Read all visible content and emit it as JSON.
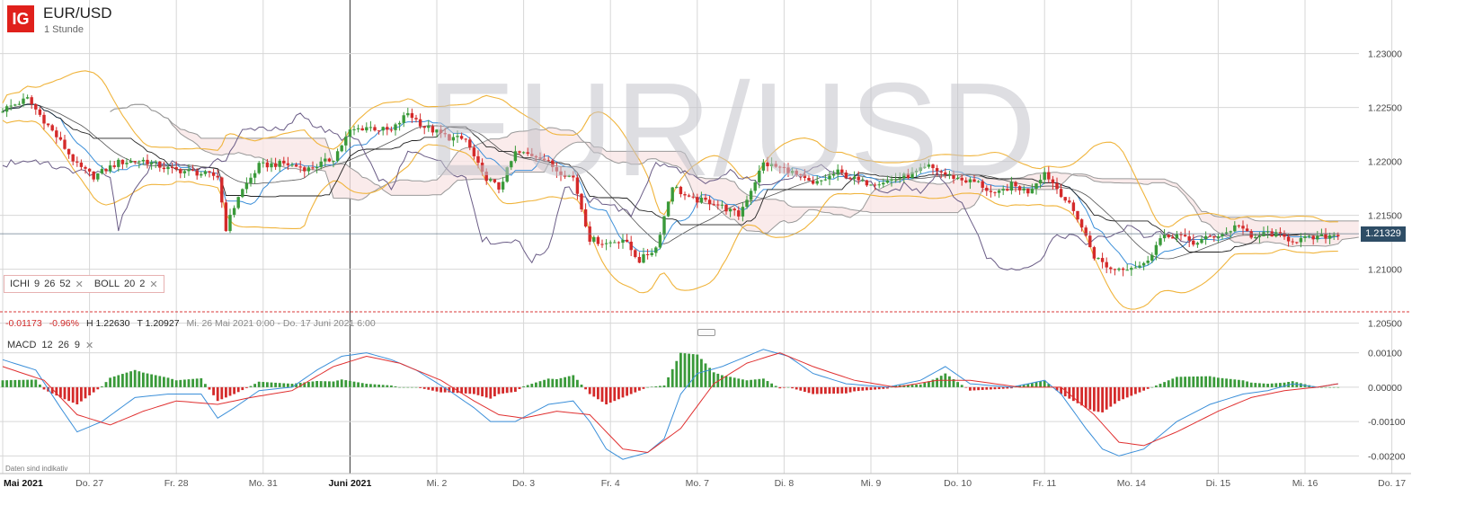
{
  "header": {
    "logo": "IG",
    "instrument": "EUR/USD",
    "interval": "1 Stunde",
    "watermark": "EUR/USD"
  },
  "indicators": {
    "ichi": {
      "name": "ICHI",
      "p1": "9",
      "p2": "26",
      "p3": "52"
    },
    "boll": {
      "name": "BOLL",
      "p1": "20",
      "p2": "2"
    },
    "macd": {
      "name": "MACD",
      "p1": "12",
      "p2": "26",
      "p3": "9"
    },
    "close_symbol": "✕"
  },
  "stats": {
    "change": "-0.01173",
    "change_pct": "-0.96%",
    "high": "H 1.22630",
    "low": "T 1.20927",
    "range": "Mi. 26 Mai 2021 0:00 - Do. 17 Juni 2021 6:00"
  },
  "footnote": "Daten sind indikativ",
  "current_price": "1.21329",
  "colors": {
    "up": "#3a9a3a",
    "down": "#d42a2a",
    "boll": "#f0b43c",
    "ichi_cloud": "#f9e6e6",
    "ichi_line": "#6a5c86",
    "price_tag": "#2e4d66"
  },
  "chart_data": [
    {
      "type": "candlestick",
      "title": "EUR/USD",
      "y_axis": {
        "range": [
          1.2048,
          1.2318
        ],
        "ticks": [
          "1.23000",
          "1.22500",
          "1.22000",
          "1.21500",
          "1.21000",
          "1.20500"
        ],
        "tick_values": [
          1.23,
          1.225,
          1.22,
          1.215,
          1.21,
          1.205
        ]
      },
      "x_axis": {
        "labels": [
          "Mai 2021",
          "Do. 27",
          "Fr. 28",
          "Mo. 31",
          "Juni 2021",
          "Mi. 2",
          "Do. 3",
          "Fr. 4",
          "Mo. 7",
          "Di. 8",
          "Mi. 9",
          "Do. 10",
          "Fr. 11",
          "Mo. 14",
          "Di. 15",
          "Mi. 16",
          "Do. 17"
        ],
        "label_index": [
          0,
          21,
          42,
          63,
          84,
          105,
          126,
          147,
          168,
          189,
          210,
          231,
          252,
          273,
          294,
          315,
          336
        ],
        "bars": 337
      },
      "grid": true,
      "indicators": [
        "Ichimoku (9, 26, 52)",
        "Bollinger (20, 2)"
      ],
      "close_path": [
        [
          0,
          1.2248
        ],
        [
          6,
          1.2258
        ],
        [
          10,
          1.2238
        ],
        [
          14,
          1.2218
        ],
        [
          18,
          1.2196
        ],
        [
          22,
          1.2186
        ],
        [
          28,
          1.2199
        ],
        [
          34,
          1.2201
        ],
        [
          40,
          1.2193
        ],
        [
          46,
          1.219
        ],
        [
          52,
          1.2186
        ],
        [
          54,
          1.2138
        ],
        [
          57,
          1.2168
        ],
        [
          62,
          1.2196
        ],
        [
          68,
          1.2198
        ],
        [
          74,
          1.2193
        ],
        [
          80,
          1.2203
        ],
        [
          84,
          1.2228
        ],
        [
          88,
          1.2232
        ],
        [
          94,
          1.2228
        ],
        [
          98,
          1.2245
        ],
        [
          102,
          1.2232
        ],
        [
          108,
          1.2222
        ],
        [
          112,
          1.222
        ],
        [
          116,
          1.2188
        ],
        [
          120,
          1.2175
        ],
        [
          124,
          1.2208
        ],
        [
          130,
          1.2205
        ],
        [
          134,
          1.2192
        ],
        [
          138,
          1.2185
        ],
        [
          142,
          1.2128
        ],
        [
          146,
          1.2124
        ],
        [
          150,
          1.2128
        ],
        [
          154,
          1.2108
        ],
        [
          158,
          1.212
        ],
        [
          162,
          1.2178
        ],
        [
          166,
          1.2165
        ],
        [
          172,
          1.2162
        ],
        [
          178,
          1.215
        ],
        [
          184,
          1.2198
        ],
        [
          190,
          1.2192
        ],
        [
          196,
          1.2178
        ],
        [
          202,
          1.219
        ],
        [
          208,
          1.218
        ],
        [
          214,
          1.2182
        ],
        [
          220,
          1.2188
        ],
        [
          224,
          1.2195
        ],
        [
          228,
          1.2188
        ],
        [
          232,
          1.2183
        ],
        [
          236,
          1.218
        ],
        [
          240,
          1.2168
        ],
        [
          244,
          1.2178
        ],
        [
          248,
          1.2172
        ],
        [
          252,
          1.219
        ],
        [
          256,
          1.217
        ],
        [
          260,
          1.2148
        ],
        [
          264,
          1.2112
        ],
        [
          268,
          1.21
        ],
        [
          272,
          1.2102
        ],
        [
          276,
          1.2104
        ],
        [
          280,
          1.2128
        ],
        [
          284,
          1.2132
        ],
        [
          288,
          1.2124
        ],
        [
          292,
          1.213
        ],
        [
          296,
          1.2134
        ],
        [
          299,
          1.2142
        ],
        [
          302,
          1.2128
        ],
        [
          306,
          1.2134
        ],
        [
          312,
          1.2127
        ],
        [
          318,
          1.2129
        ],
        [
          323,
          1.2133
        ]
      ],
      "last_price": 1.21329
    },
    {
      "type": "bar",
      "title": "MACD",
      "y_axis": {
        "range": [
          -0.0022,
          0.0012
        ],
        "ticks": [
          "0.00100",
          "0.00000",
          "-0.00100",
          "-0.00200"
        ],
        "tick_values": [
          0.001,
          0,
          -0.001,
          -0.002
        ]
      },
      "macd_path": [
        [
          0,
          0.0008
        ],
        [
          8,
          0.0005
        ],
        [
          14,
          -0.0006
        ],
        [
          18,
          -0.0013
        ],
        [
          24,
          -0.001
        ],
        [
          32,
          -0.0003
        ],
        [
          40,
          -0.0002
        ],
        [
          48,
          -0.0002
        ],
        [
          52,
          -0.0009
        ],
        [
          56,
          -0.0006
        ],
        [
          62,
          -0.0001
        ],
        [
          70,
          0.0
        ],
        [
          76,
          0.0005
        ],
        [
          82,
          0.0009
        ],
        [
          88,
          0.001
        ],
        [
          94,
          0.0008
        ],
        [
          100,
          0.0005
        ],
        [
          108,
          -0.0001
        ],
        [
          114,
          -0.0006
        ],
        [
          118,
          -0.001
        ],
        [
          124,
          -0.001
        ],
        [
          132,
          -0.0005
        ],
        [
          138,
          -0.0004
        ],
        [
          142,
          -0.001
        ],
        [
          146,
          -0.0018
        ],
        [
          150,
          -0.0021
        ],
        [
          156,
          -0.0019
        ],
        [
          160,
          -0.0015
        ],
        [
          164,
          -0.0002
        ],
        [
          168,
          0.0004
        ],
        [
          174,
          0.0006
        ],
        [
          180,
          0.0009
        ],
        [
          184,
          0.0011
        ],
        [
          190,
          0.0009
        ],
        [
          196,
          0.0004
        ],
        [
          204,
          0.0001
        ],
        [
          214,
          0.0
        ],
        [
          222,
          0.0002
        ],
        [
          228,
          0.0006
        ],
        [
          234,
          0.0001
        ],
        [
          244,
          0.0
        ],
        [
          252,
          0.0002
        ],
        [
          256,
          -0.0002
        ],
        [
          262,
          -0.0012
        ],
        [
          266,
          -0.0018
        ],
        [
          270,
          -0.002
        ],
        [
          276,
          -0.0018
        ],
        [
          284,
          -0.001
        ],
        [
          292,
          -0.0005
        ],
        [
          300,
          -0.0002
        ],
        [
          306,
          -0.0001
        ],
        [
          312,
          0.0001
        ],
        [
          318,
          0.0
        ],
        [
          323,
          0.0001
        ]
      ],
      "signal_path": [
        [
          0,
          0.0006
        ],
        [
          10,
          0.0002
        ],
        [
          18,
          -0.0008
        ],
        [
          26,
          -0.0011
        ],
        [
          34,
          -0.0007
        ],
        [
          42,
          -0.0004
        ],
        [
          52,
          -0.0005
        ],
        [
          60,
          -0.0003
        ],
        [
          70,
          -0.0001
        ],
        [
          80,
          0.0006
        ],
        [
          88,
          0.0009
        ],
        [
          96,
          0.0007
        ],
        [
          106,
          0.0002
        ],
        [
          114,
          -0.0004
        ],
        [
          120,
          -0.0008
        ],
        [
          126,
          -0.0009
        ],
        [
          134,
          -0.0007
        ],
        [
          142,
          -0.0008
        ],
        [
          150,
          -0.0018
        ],
        [
          156,
          -0.0019
        ],
        [
          164,
          -0.0012
        ],
        [
          172,
          0.0001
        ],
        [
          180,
          0.0007
        ],
        [
          188,
          0.001
        ],
        [
          196,
          0.0006
        ],
        [
          206,
          0.0002
        ],
        [
          216,
          0.0
        ],
        [
          226,
          0.0002
        ],
        [
          234,
          0.0002
        ],
        [
          246,
          0.0
        ],
        [
          256,
          0.0
        ],
        [
          264,
          -0.0008
        ],
        [
          270,
          -0.0016
        ],
        [
          276,
          -0.0017
        ],
        [
          284,
          -0.0013
        ],
        [
          294,
          -0.0007
        ],
        [
          302,
          -0.0003
        ],
        [
          310,
          -0.0001
        ],
        [
          318,
          0.0
        ],
        [
          323,
          0.0001
        ]
      ]
    }
  ]
}
